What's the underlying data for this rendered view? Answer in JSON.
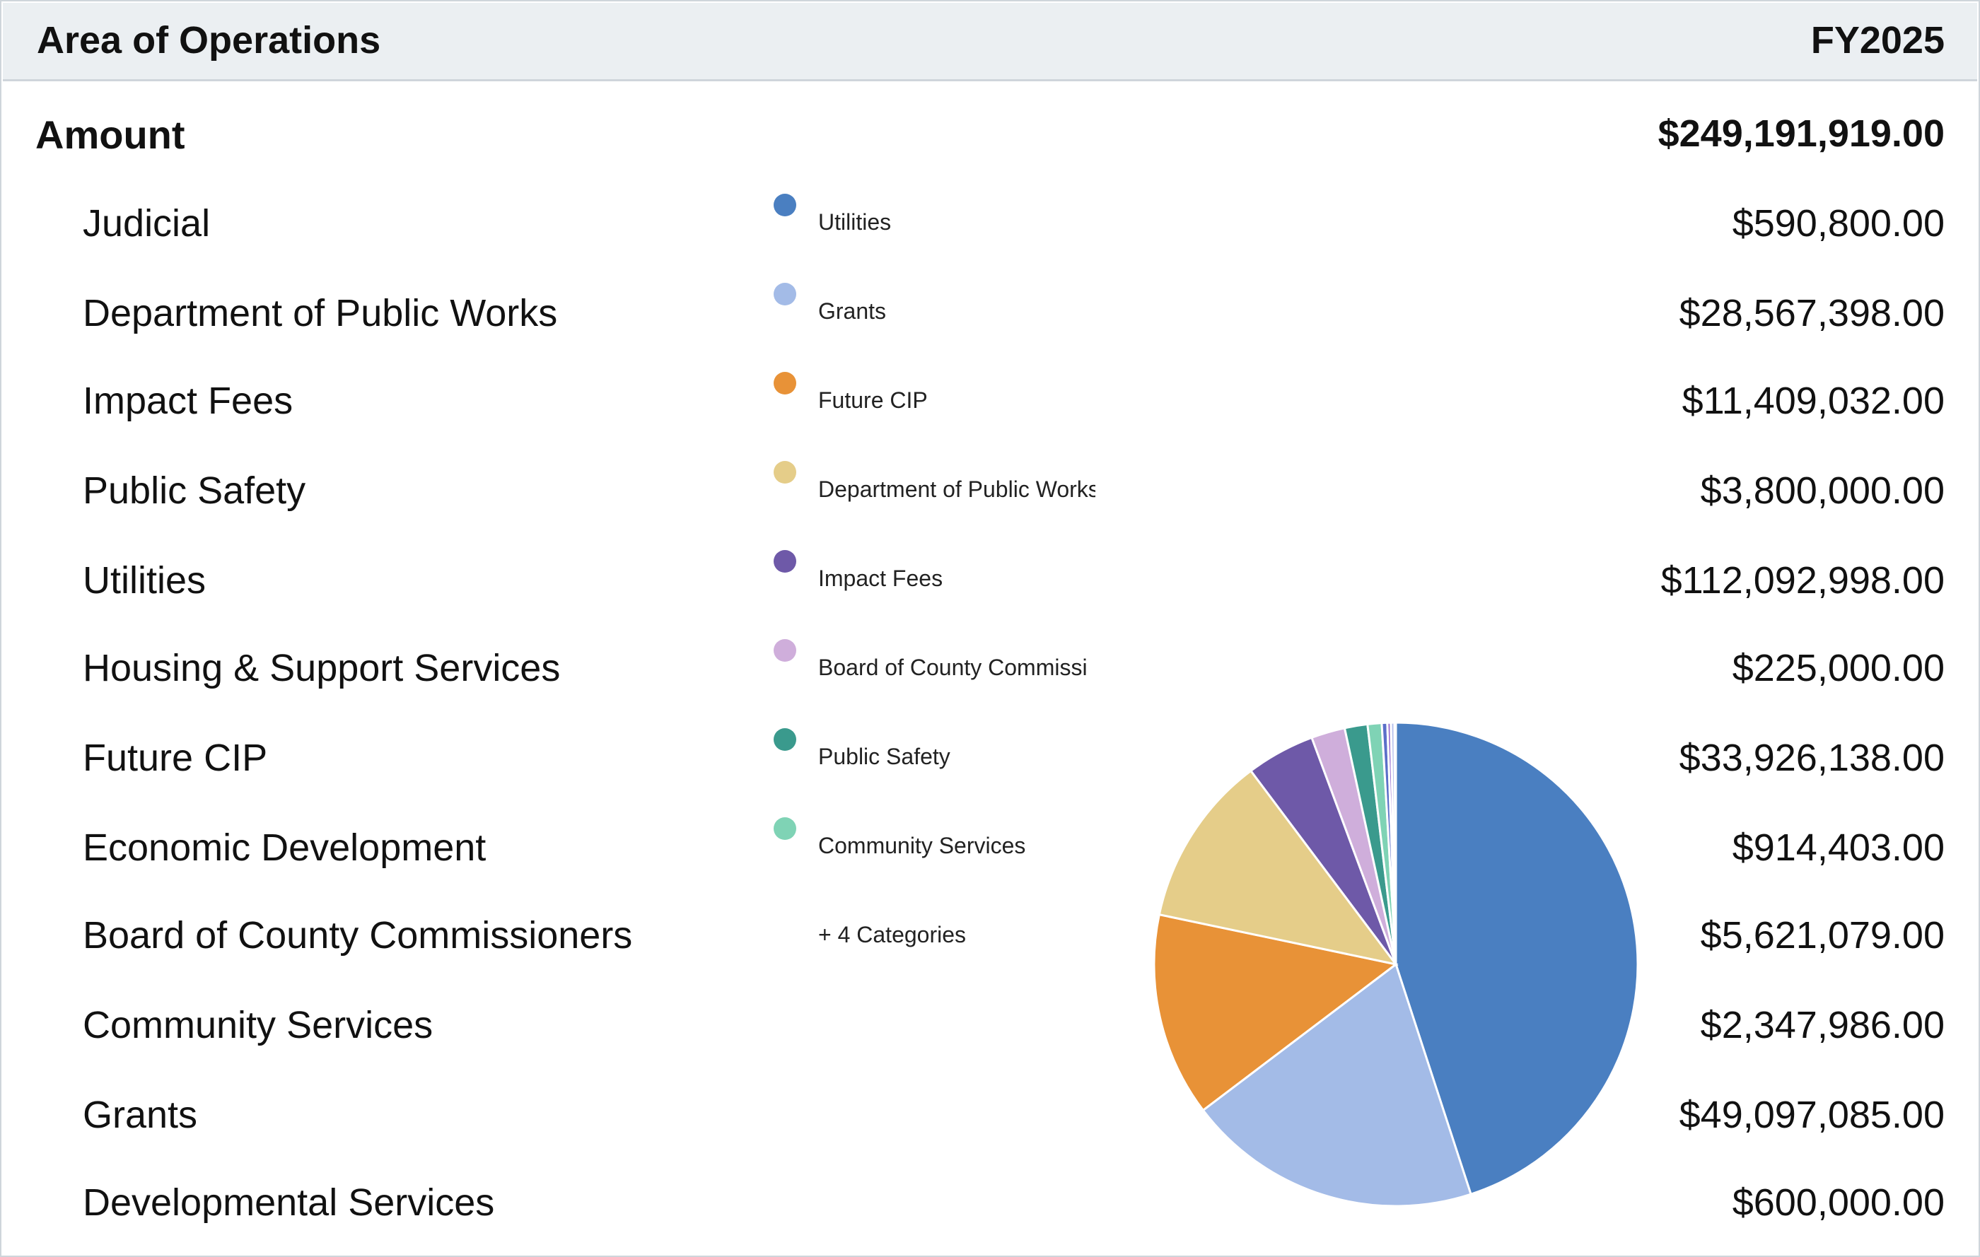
{
  "header": {
    "title": "Area of Operations",
    "year": "FY2025"
  },
  "total": {
    "label": "Amount",
    "value": "$249,191,919.00"
  },
  "rows": [
    {
      "label": "Judicial",
      "value": "$590,800.00"
    },
    {
      "label": "Department of Public Works",
      "value": "$28,567,398.00"
    },
    {
      "label": "Impact Fees",
      "value": "$11,409,032.00"
    },
    {
      "label": "Public Safety",
      "value": "$3,800,000.00"
    },
    {
      "label": "Utilities",
      "value": "$112,092,998.00"
    },
    {
      "label": "Housing & Support Services",
      "value": "$225,000.00"
    },
    {
      "label": "Future CIP",
      "value": "$33,926,138.00"
    },
    {
      "label": "Economic Development",
      "value": "$914,403.00"
    },
    {
      "label": "Board of County Commissioners",
      "value": "$5,621,079.00"
    },
    {
      "label": "Community Services",
      "value": "$2,347,986.00"
    },
    {
      "label": "Grants",
      "value": "$49,097,085.00"
    },
    {
      "label": "Developmental Services",
      "value": "$600,000.00"
    }
  ],
  "legend": {
    "items": [
      {
        "label": "Utilities",
        "color": "#4a7fc1"
      },
      {
        "label": "Grants",
        "color": "#a3bbe7"
      },
      {
        "label": "Future CIP",
        "color": "#e89237"
      },
      {
        "label": "Department of Public Works",
        "color": "#e5cd89"
      },
      {
        "label": "Impact Fees",
        "color": "#6e59a8"
      },
      {
        "label": "Board of County Commissi",
        "color": "#cfaedb"
      },
      {
        "label": "Public Safety",
        "color": "#3a9a8d"
      },
      {
        "label": "Community Services",
        "color": "#7fd3b5"
      }
    ],
    "more": "+ 4 Categories"
  },
  "chart_data": {
    "type": "pie",
    "categories": [
      "Utilities",
      "Grants",
      "Future CIP",
      "Department of Public Works",
      "Impact Fees",
      "Board of County Commissioners",
      "Public Safety",
      "Community Services",
      "Economic Development",
      "Judicial",
      "Developmental Services",
      "Housing & Support Services"
    ],
    "values": [
      112092998,
      49097085,
      33926138,
      28567398,
      11409032,
      5621079,
      3800000,
      2347986,
      914403,
      590800,
      600000,
      225000
    ],
    "colors": [
      "#4a7fc1",
      "#a3bbe7",
      "#e89237",
      "#e5cd89",
      "#6e59a8",
      "#cfaedb",
      "#3a9a8d",
      "#7fd3b5",
      "#5b6fc9",
      "#9a6fd0",
      "#b7c1ec",
      "#e8b0c9"
    ],
    "legend_position": "left-of-pie"
  }
}
